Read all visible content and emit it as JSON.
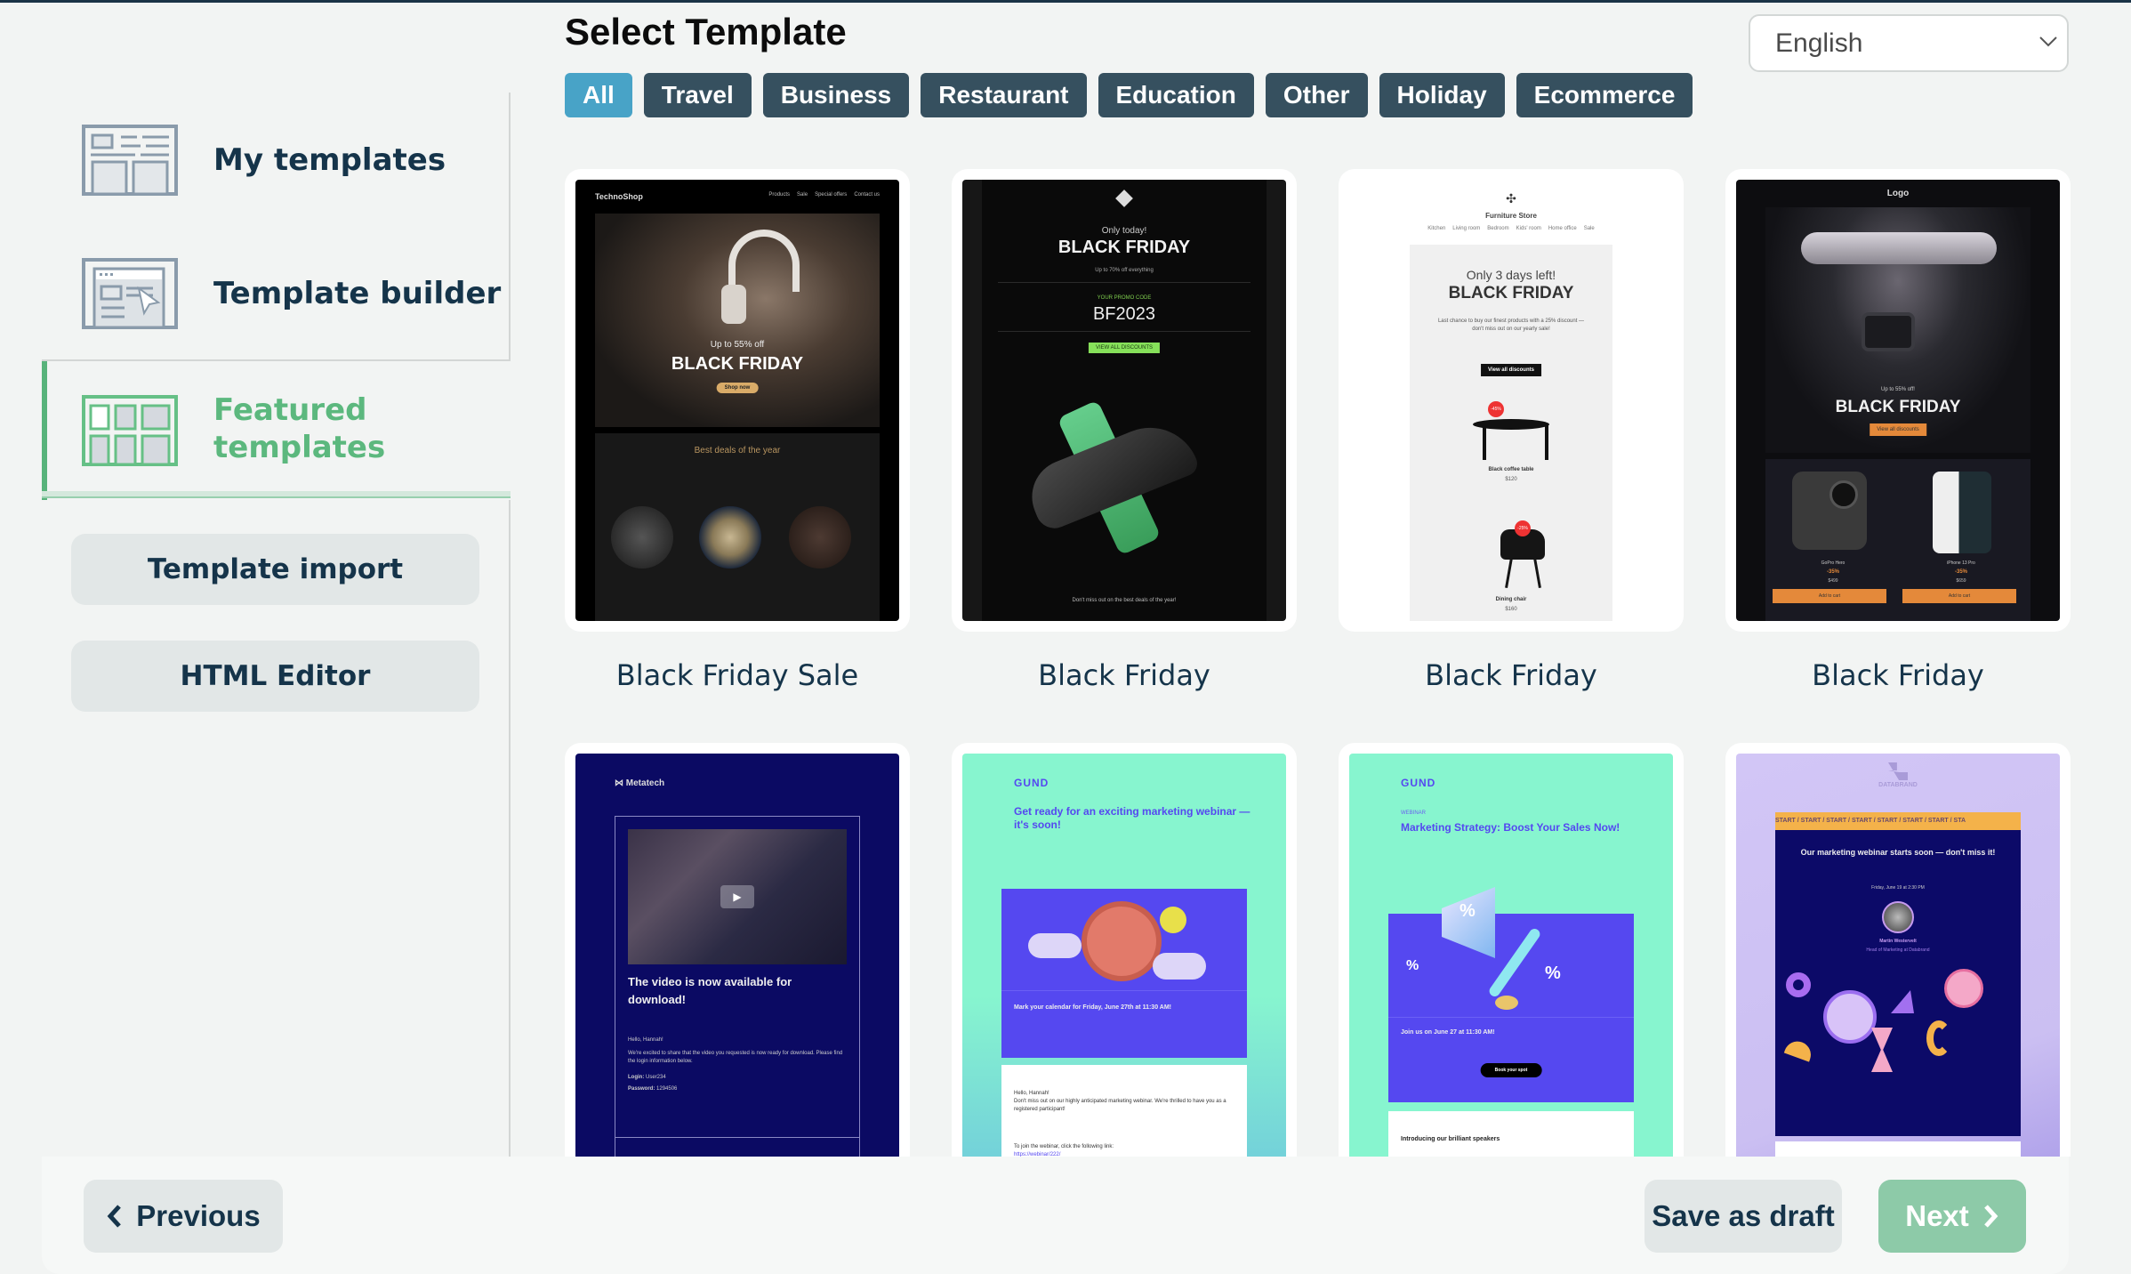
{
  "sidebar": {
    "items": [
      {
        "label": "My templates",
        "icon": "template-layout-icon",
        "active": false
      },
      {
        "label": "Template builder",
        "icon": "template-builder-cursor-icon",
        "active": false
      },
      {
        "label": "Featured templates",
        "icon": "featured-grid-icon",
        "active": true
      }
    ],
    "buttons": [
      {
        "label": "Template import"
      },
      {
        "label": "HTML Editor"
      }
    ]
  },
  "main": {
    "title": "Select Template",
    "filters": [
      {
        "label": "All",
        "active": true
      },
      {
        "label": "Travel",
        "active": false
      },
      {
        "label": "Business",
        "active": false
      },
      {
        "label": "Restaurant",
        "active": false
      },
      {
        "label": "Education",
        "active": false
      },
      {
        "label": "Other",
        "active": false
      },
      {
        "label": "Holiday",
        "active": false
      },
      {
        "label": "Ecommerce",
        "active": false
      }
    ],
    "language": {
      "selected": "English"
    },
    "templates": [
      {
        "name": "Black Friday Sale",
        "preview": {
          "brand": "TechnoShop",
          "nav": [
            "Products",
            "Sale",
            "Special offers",
            "Contact us"
          ],
          "kicker": "Up to 55% off",
          "headline": "BLACK FRIDAY",
          "cta": "Shop now",
          "section": "Best deals of the year"
        }
      },
      {
        "name": "Black Friday",
        "preview": {
          "kicker": "Only today!",
          "headline": "BLACK FRIDAY",
          "sub": "Up to 70% off everything",
          "promo_label": "YOUR PROMO CODE",
          "promo_code": "BF2023",
          "cta": "VIEW ALL DISCOUNTS",
          "footer": "Don't miss out on the best deals of the year!"
        }
      },
      {
        "name": "Black Friday",
        "preview": {
          "brand": "Furniture Store",
          "nav": [
            "Kitchen",
            "Living room",
            "Bedroom",
            "Kids' room",
            "Home office",
            "Sale"
          ],
          "kicker": "Only 3 days left!",
          "headline": "BLACK FRIDAY",
          "body": "Last chance to buy our finest products with a 25% discount — don't miss out on our yearly sale!",
          "cta": "View all discounts",
          "products": [
            {
              "name": "Black coffee table",
              "price": "$120",
              "badge": "-45%"
            },
            {
              "name": "Dining chair",
              "price": "$160",
              "badge": "-25%"
            }
          ]
        }
      },
      {
        "name": "Black Friday",
        "preview": {
          "brand": "Logo",
          "kicker": "Up to 55% off!",
          "headline": "BLACK FRIDAY",
          "cta": "View all discounts",
          "products": [
            {
              "name": "GoPro Hero",
              "discount": "-35%",
              "price": "$499",
              "cta": "Add to cart"
            },
            {
              "name": "iPhone 13 Pro",
              "discount": "-35%",
              "price": "$659",
              "cta": "Add to cart"
            }
          ]
        }
      },
      {
        "name": "",
        "preview": {
          "brand": "Metatech",
          "headline": "The video is now available for download!",
          "greeting": "Hello, Hannah!",
          "body": "We're excited to share that the video you requested is now ready for download. Please find the login information below.",
          "login_label": "Login:",
          "login": "User234",
          "password_label": "Password:",
          "password": "1294506"
        }
      },
      {
        "name": "",
        "preview": {
          "brand": "GUND",
          "headline": "Get ready for an exciting marketing webinar — it's soon!",
          "date": "Mark your calendar for Friday, June 27th at 11:30 AM!",
          "greeting": "Hello, Hannah!",
          "body": "Don't miss out on our highly anticipated marketing webinar. We're thrilled to have you as a registered participant!",
          "link_label": "To join the webinar, click the following link:",
          "link": "https://webinar/222/"
        }
      },
      {
        "name": "",
        "preview": {
          "brand": "GUND",
          "kicker": "WEBINAR",
          "headline": "Marketing Strategy: Boost Your Sales Now!",
          "date": "Join us on June 27 at 11:30 AM!",
          "cta": "Book your spot",
          "section": "Introducing our brilliant speakers"
        }
      },
      {
        "name": "",
        "preview": {
          "brand": "DATABRAND",
          "ticker": "START / START / START / START / START / START / START / STA",
          "headline": "Our marketing webinar starts soon — don't miss it!",
          "date": "Friday, June 19 at 2:30 PM",
          "speaker": "Martin Westervelt",
          "speaker_title": "Head of Marketing at Databrand"
        }
      }
    ]
  },
  "footer": {
    "previous_label": "Previous",
    "save_draft_label": "Save as draft",
    "next_label": "Next"
  },
  "colors": {
    "accent_green": "#5cb87e",
    "chip_active": "#48a3c7",
    "chip": "#36505f",
    "next_button": "#8dcaa8",
    "text_dark": "#15344a"
  }
}
